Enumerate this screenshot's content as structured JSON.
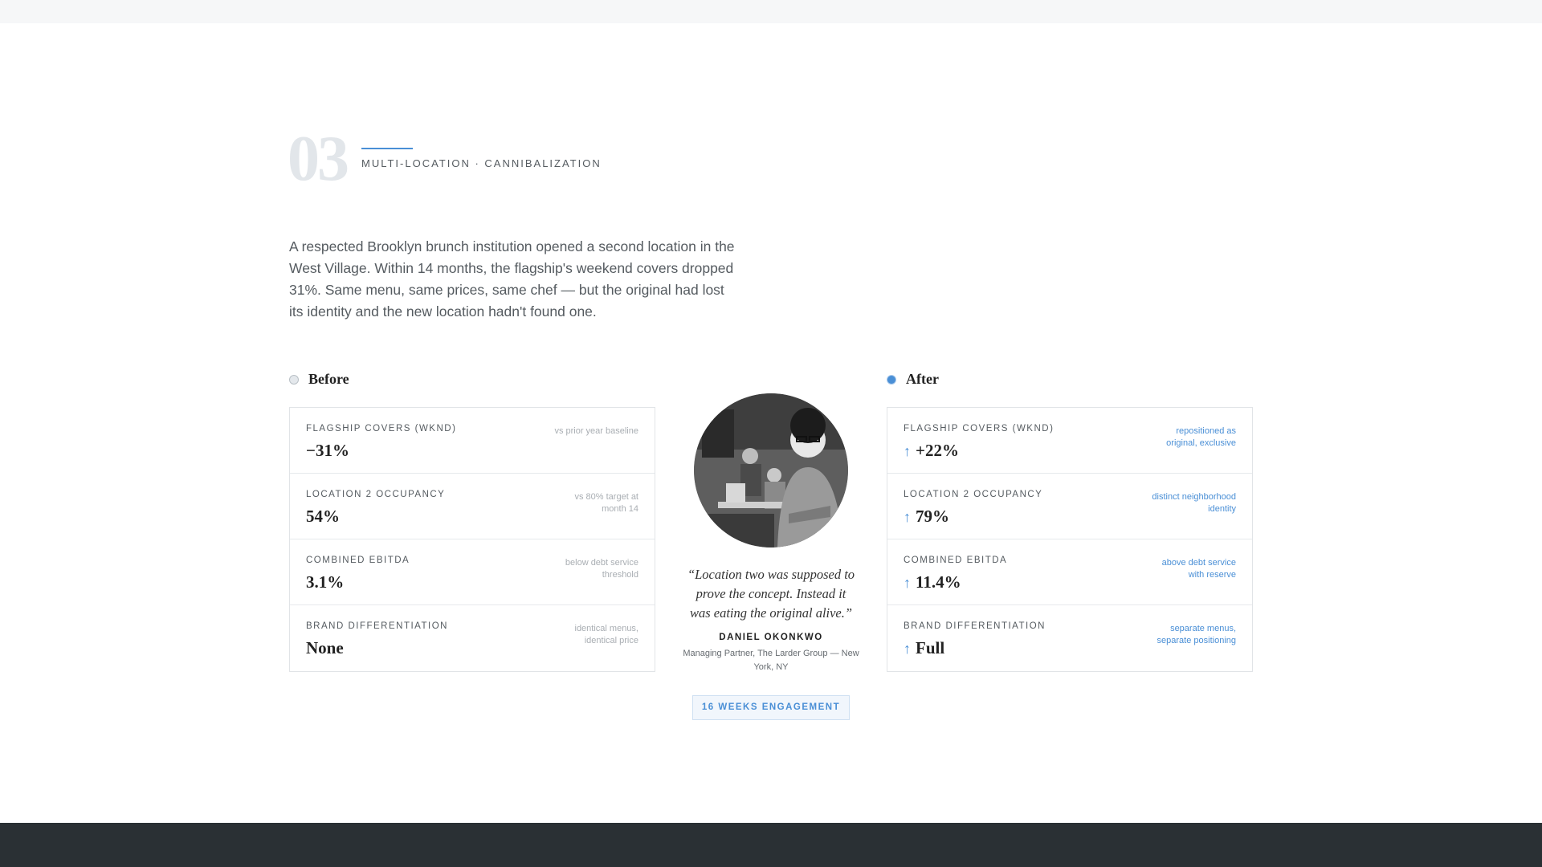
{
  "section": {
    "number": "03",
    "eyebrow": "MULTI-LOCATION · CANNIBALIZATION",
    "intro": "A respected Brooklyn brunch institution opened a second location in the West Village. Within 14 months, the flagship's weekend covers dropped 31%. Same menu, same prices, same chef — but the original had lost its identity and the new location hadn't found one."
  },
  "before": {
    "title": "Before",
    "metrics": [
      {
        "label": "FLAGSHIP COVERS (WKND)",
        "value": "−31%",
        "note": "vs prior year baseline"
      },
      {
        "label": "LOCATION 2 OCCUPANCY",
        "value": "54%",
        "note": "vs 80% target at month 14"
      },
      {
        "label": "COMBINED EBITDA",
        "value": "3.1%",
        "note": "below debt service threshold"
      },
      {
        "label": "BRAND DIFFERENTIATION",
        "value": "None",
        "note": "identical menus, identical price"
      }
    ]
  },
  "after": {
    "title": "After",
    "arrow": "↑",
    "metrics": [
      {
        "label": "FLAGSHIP COVERS (WKND)",
        "value": "+22%",
        "note": "repositioned as original, exclusive"
      },
      {
        "label": "LOCATION 2 OCCUPANCY",
        "value": "79%",
        "note": "distinct neighborhood identity"
      },
      {
        "label": "COMBINED EBITDA",
        "value": "11.4%",
        "note": "above debt service with reserve"
      },
      {
        "label": "BRAND DIFFERENTIATION",
        "value": "Full",
        "note": "separate menus, separate positioning"
      }
    ]
  },
  "testimonial": {
    "quote": "“Location two was supposed to prove the concept. Instead it was eating the original alive.”",
    "author": "DANIEL OKONKWO",
    "role": "Managing Partner, The Larder Group — New York, NY"
  },
  "badge": "16 WEEKS ENGAGEMENT",
  "colors": {
    "accent": "#4a8fd6",
    "footer": "#2a3034"
  }
}
